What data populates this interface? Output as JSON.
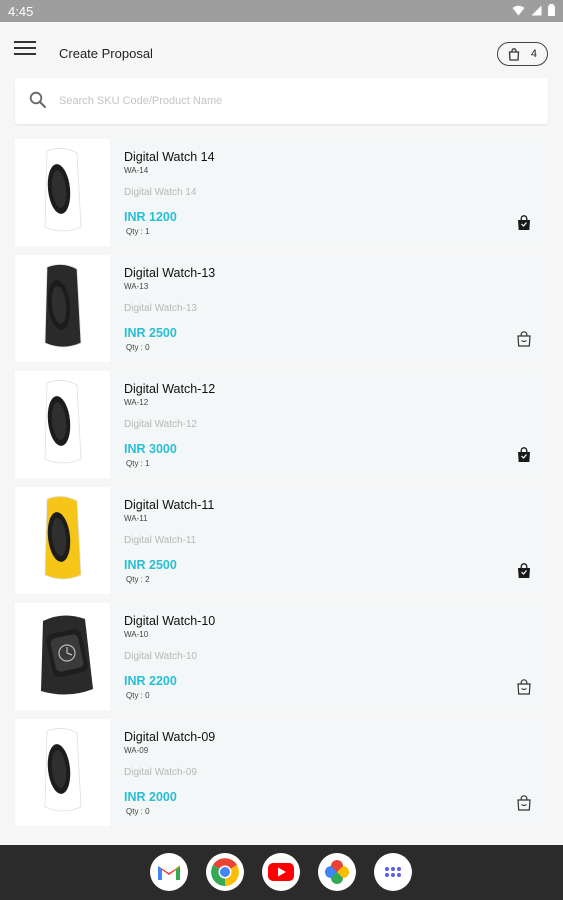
{
  "status": {
    "time": "4:45"
  },
  "header": {
    "title": "Create Proposal",
    "cart_count": "4"
  },
  "search": {
    "placeholder": "Search SKU Code/Product Name",
    "value": ""
  },
  "products": [
    {
      "name": "Digital Watch 14",
      "sku": "WA-14",
      "description": "Digital Watch 14",
      "price": "INR 1200",
      "qty": "Qty : 1",
      "band_color": "#ffffff",
      "in_cart": true
    },
    {
      "name": "Digital Watch-13",
      "sku": "WA-13",
      "description": "Digital Watch-13",
      "price": "INR 2500",
      "qty": "Qty : 0",
      "band_color": "#2a2a2a",
      "in_cart": false
    },
    {
      "name": "Digital Watch-12",
      "sku": "WA-12",
      "description": "Digital Watch-12",
      "price": "INR 3000",
      "qty": "Qty : 1",
      "band_color": "#ffffff",
      "in_cart": true
    },
    {
      "name": "Digital Watch-11",
      "sku": "WA-11",
      "description": "Digital Watch-11",
      "price": "INR 2500",
      "qty": "Qty : 2",
      "band_color": "#f5c518",
      "in_cart": true
    },
    {
      "name": "Digital Watch-10",
      "sku": "WA-10",
      "description": "Digital Watch-10",
      "price": "INR 2200",
      "qty": "Qty : 0",
      "band_color": "#2a2a2a",
      "in_cart": false
    },
    {
      "name": "Digital Watch-09",
      "sku": "WA-09",
      "description": "Digital Watch-09",
      "price": "INR 2000",
      "qty": "Qty : 0",
      "band_color": "#ffffff",
      "in_cart": false
    }
  ],
  "dock": [
    "gmail-icon",
    "chrome-icon",
    "youtube-icon",
    "photos-icon",
    "app-drawer-icon"
  ],
  "colors": {
    "accent": "#27bfd6",
    "card_bg": "#f4f7f7",
    "nav_bar": "#2b2b2b"
  }
}
